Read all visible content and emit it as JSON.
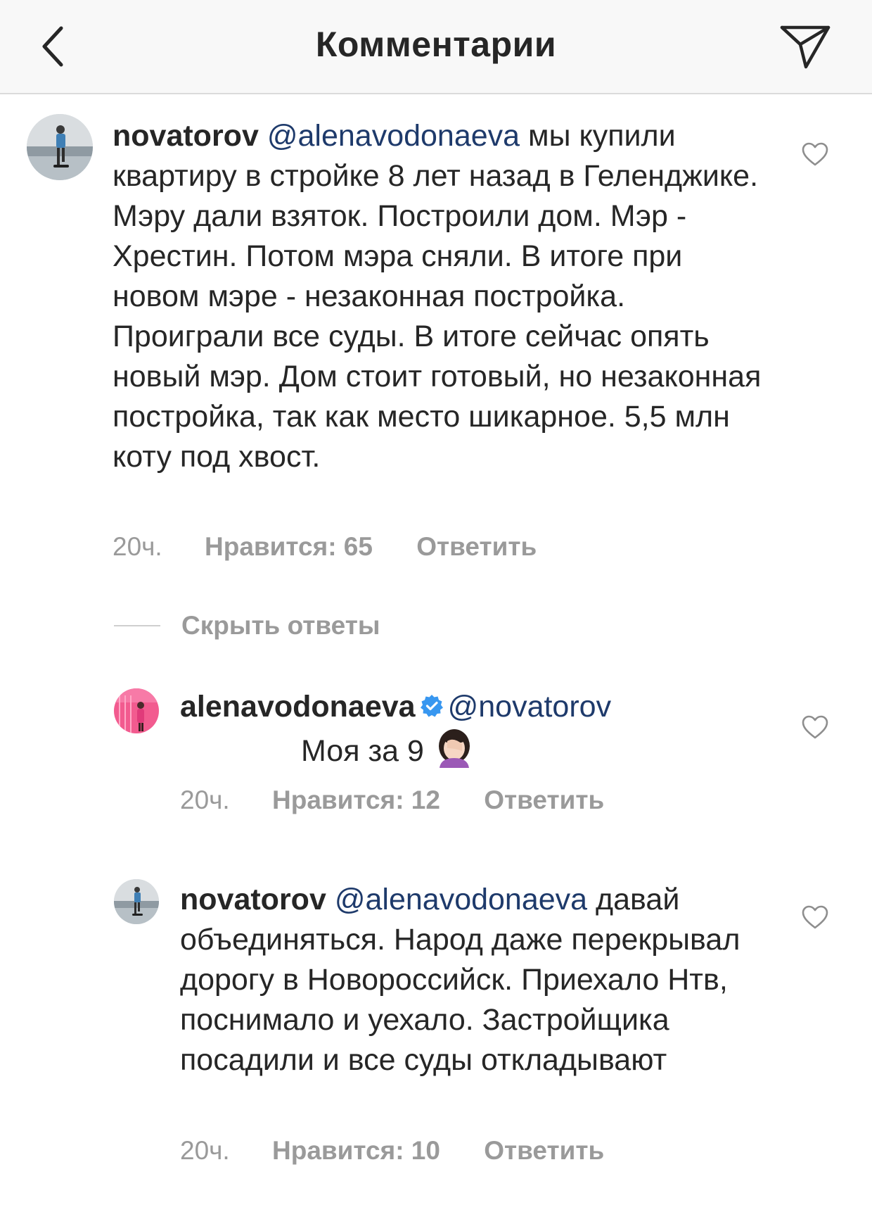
{
  "header": {
    "title": "Комментарии"
  },
  "comments": [
    {
      "username": "novatorov",
      "mention": "@alenavodonaeva",
      "text": " мы купили квартиру в стройке 8 лет назад в Геленджике. Мэру дали взяток. Построили дом. Мэр - Хрестин. Потом мэра сняли. В итоге при новом мэре - незаконная постройка. Проиграли все суды. В итоге сейчас опять новый мэр. Дом стоит готовый, но незаконная постройка, так как место шикарное. 5,5 млн коту под хвост.",
      "time": "20ч.",
      "likes": "Нравится: 65",
      "reply": "Ответить"
    }
  ],
  "replies_toggle": "Скрыть ответы",
  "replies": [
    {
      "username": "alenavodonaeva",
      "mention": "@novatorov",
      "text": "Моя за 9",
      "time": "20ч.",
      "likes": "Нравится: 12",
      "reply": "Ответить"
    },
    {
      "username": "novatorov",
      "mention": "@alenavodonaeva",
      "text": " давай объединяться. Народ даже перекрывал дорогу в Новороссийск. Приехало Нтв, поснимало и уехало. Застройщика посадили и все суды откладывают",
      "time": "20ч.",
      "likes": "Нравится: 10",
      "reply": "Ответить"
    }
  ],
  "colors": {
    "mention": "#1e3a6b",
    "meta": "#9a9a9a",
    "verified": "#3897f0"
  }
}
